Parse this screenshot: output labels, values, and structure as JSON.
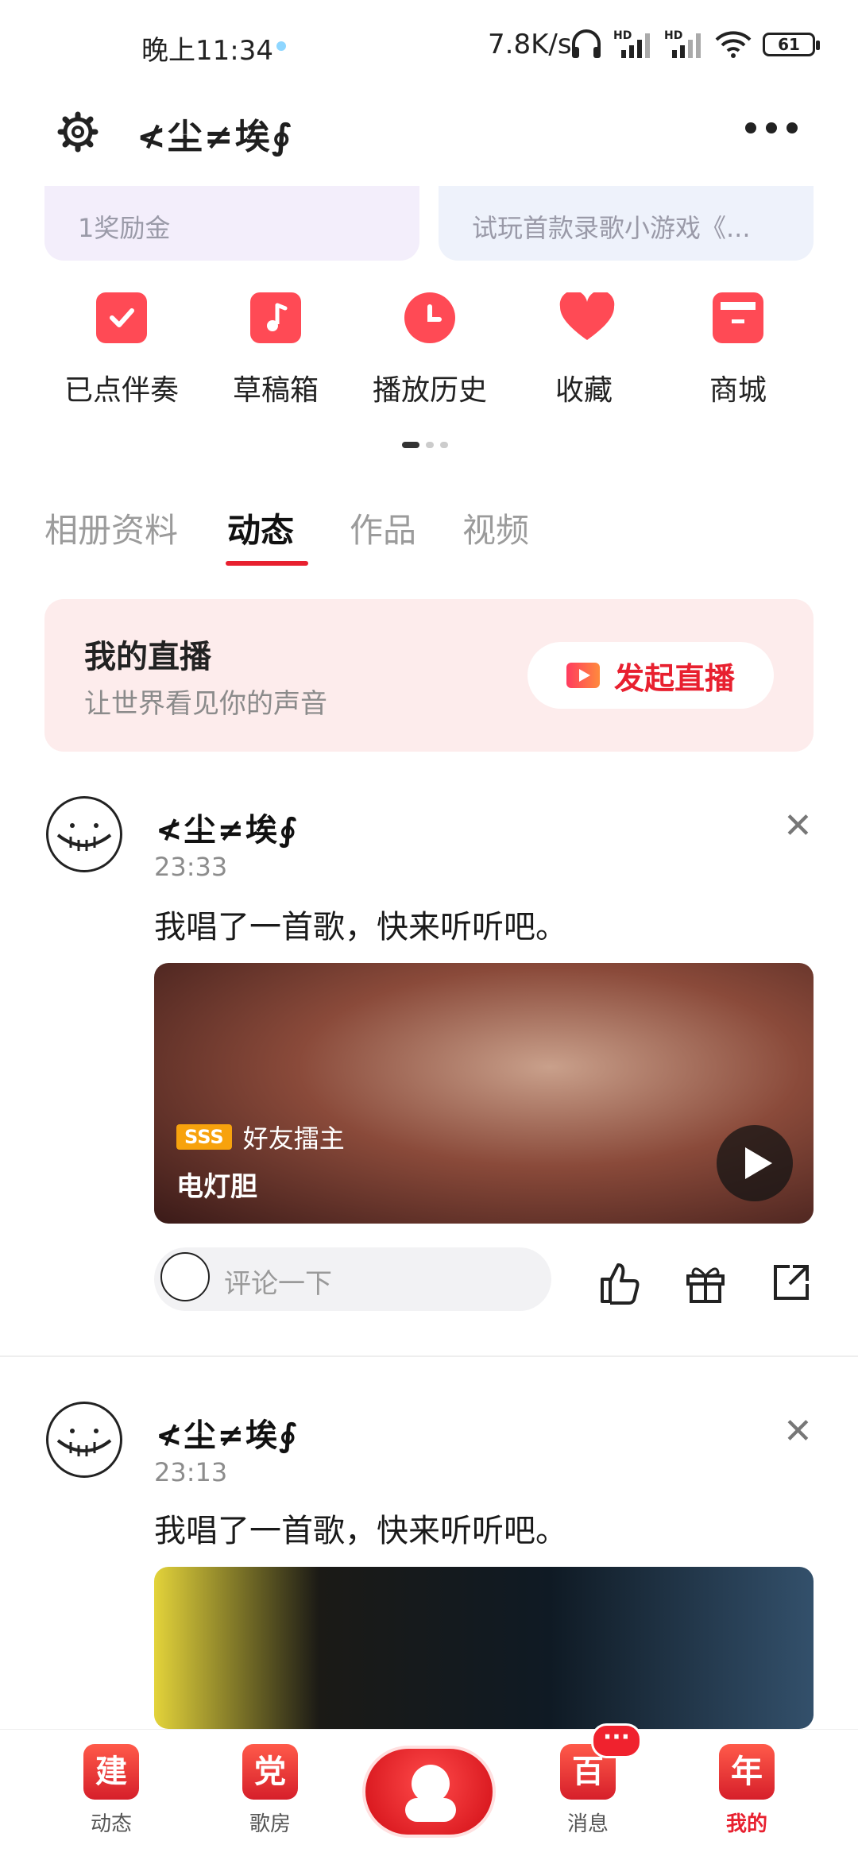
{
  "status_bar": {
    "time": "晚上11:34",
    "net_speed": "7.8K/s",
    "signal_1": "HD",
    "signal_2": "HD",
    "battery": "61"
  },
  "header": {
    "title": "≮尘≠埃∮"
  },
  "promo_cards": [
    {
      "subtitle": "1奖励金"
    },
    {
      "subtitle": "试玩首款录歌小游戏《..."
    }
  ],
  "quick_actions": [
    {
      "label": "已点伴奏",
      "icon": "check-icon"
    },
    {
      "label": "草稿箱",
      "icon": "music-note-icon"
    },
    {
      "label": "播放历史",
      "icon": "clock-icon"
    },
    {
      "label": "收藏",
      "icon": "heart-icon"
    },
    {
      "label": "商城",
      "icon": "shop-icon"
    }
  ],
  "tabs": [
    {
      "label": "相册资料",
      "active": false
    },
    {
      "label": "动态",
      "active": true
    },
    {
      "label": "作品",
      "active": false
    },
    {
      "label": "视频",
      "active": false
    }
  ],
  "live": {
    "title": "我的直播",
    "subtitle": "让世界看见你的声音",
    "button": "发起直播"
  },
  "posts": [
    {
      "name": "≮尘≠埃∮",
      "time": "23:33",
      "text": "我唱了一首歌，快来听听吧。",
      "badge": "SSS",
      "tag": "好友擂主",
      "song": "电灯胆",
      "comment_placeholder": "评论一下"
    },
    {
      "name": "≮尘≠埃∮",
      "time": "23:13",
      "text": "我唱了一首歌，快来听听吧。"
    }
  ],
  "bottom_nav": [
    {
      "label": "动态",
      "glyph": "建"
    },
    {
      "label": "歌房",
      "glyph": "党"
    },
    {
      "label": "消息",
      "glyph": "百",
      "badge": "···"
    },
    {
      "label": "我的",
      "glyph": "年",
      "active": true
    }
  ],
  "colors": {
    "accent": "#e8202f",
    "live_bg": "#fdecec"
  }
}
